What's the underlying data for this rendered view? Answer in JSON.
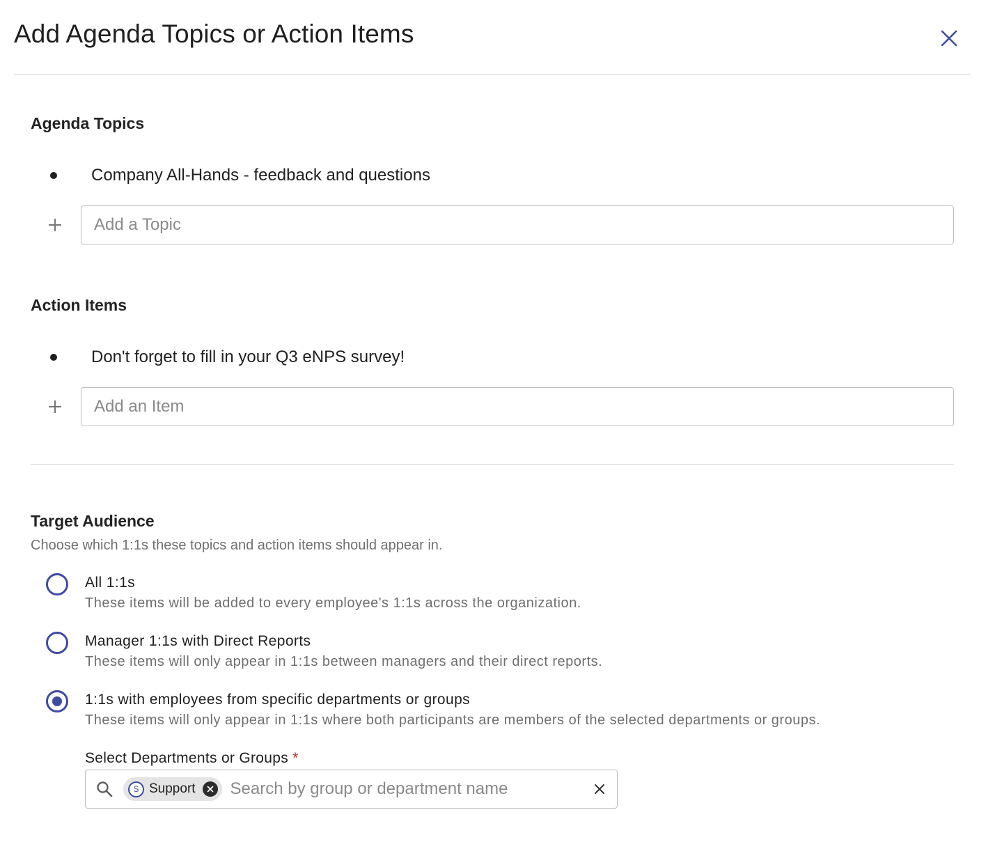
{
  "dialog": {
    "title": "Add Agenda Topics or Action Items",
    "close_icon": "close-icon"
  },
  "agenda": {
    "heading": "Agenda Topics",
    "items": [
      "Company All-Hands - feedback and questions"
    ],
    "add_placeholder": "Add a Topic"
  },
  "actions": {
    "heading": "Action Items",
    "items": [
      "Don't forget to fill in your Q3 eNPS survey!"
    ],
    "add_placeholder": "Add an Item"
  },
  "audience": {
    "heading": "Target Audience",
    "subtitle": "Choose which 1:1s these topics and action items should appear in.",
    "options": [
      {
        "label": "All 1:1s",
        "description": "These items will be added to every employee's 1:1s across the organization.",
        "selected": false
      },
      {
        "label": "Manager 1:1s with Direct Reports",
        "description": "These items will only appear in 1:1s between managers and their direct reports.",
        "selected": false
      },
      {
        "label": "1:1s with employees from specific departments or groups",
        "description": "These items will only appear in 1:1s where both participants are members of the selected departments or groups.",
        "selected": true
      }
    ],
    "select_label": "Select Departments or Groups",
    "required_mark": "*",
    "chips": [
      {
        "avatar": "S",
        "label": "Support"
      }
    ],
    "search_placeholder": "Search by group or department name"
  },
  "colors": {
    "accent": "#3f4ba3",
    "required": "#c62828"
  }
}
